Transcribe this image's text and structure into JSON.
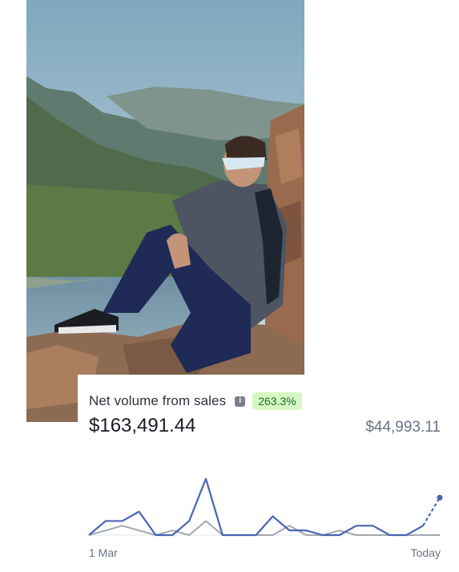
{
  "metric": {
    "title": "Net volume from sales",
    "change": "263.3%",
    "value": "$163,491.44",
    "compare_value": "$44,993.11",
    "axis_start": "1 Mar",
    "axis_end": "Today"
  },
  "colors": {
    "current_series": "#4a64b3",
    "previous_series": "#a3a7ae",
    "badge_bg": "#d7f7c2",
    "badge_text": "#1f6b34"
  },
  "chart_data": {
    "type": "line",
    "x": [
      "1 Mar",
      "",
      "",
      "",
      "",
      "",
      "",
      "",
      "",
      "",
      "",
      "",
      "",
      "",
      "",
      "",
      "",
      "",
      "",
      "",
      "",
      "Today"
    ],
    "series": [
      {
        "values": [
          0,
          3,
          3,
          5,
          0,
          0,
          3,
          12,
          0,
          0,
          0,
          4,
          1,
          1,
          0,
          0,
          2,
          2,
          0,
          0,
          2,
          8
        ]
      },
      {
        "values": [
          0,
          1,
          2,
          1,
          0,
          1,
          0,
          3,
          0,
          0,
          0,
          0,
          2,
          0,
          0,
          1,
          0,
          0,
          0,
          0,
          0,
          0
        ]
      }
    ],
    "ylim": [
      0,
      13
    ],
    "grid": false
  },
  "icons": {
    "info": "info-icon"
  }
}
